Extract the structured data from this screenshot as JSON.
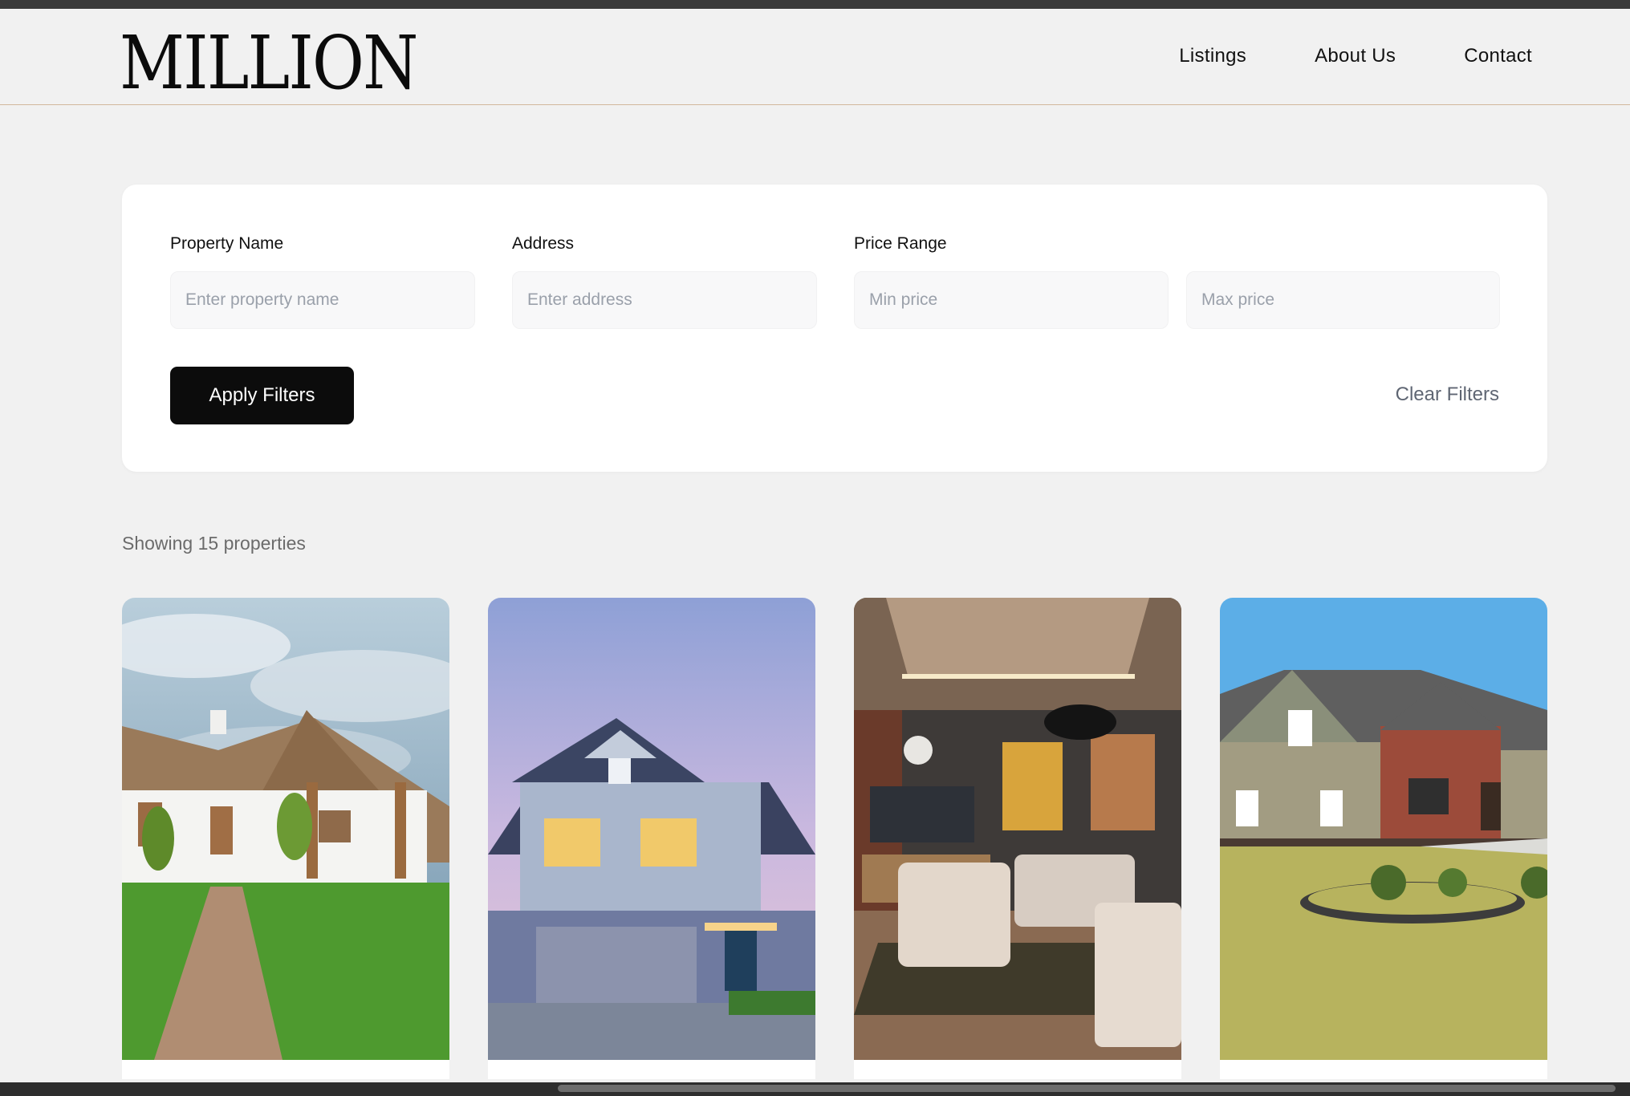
{
  "header": {
    "logo": "MILLION",
    "nav": [
      "Listings",
      "About Us",
      "Contact"
    ]
  },
  "filters": {
    "property_name": {
      "label": "Property Name",
      "placeholder": "Enter property name"
    },
    "address": {
      "label": "Address",
      "placeholder": "Enter address"
    },
    "price_range": {
      "label": "Price Range",
      "min_placeholder": "Min price",
      "max_placeholder": "Max price"
    },
    "apply_label": "Apply Filters",
    "clear_label": "Clear Filters"
  },
  "results": {
    "summary": "Showing 15 properties"
  },
  "colors": {
    "accent_border": "#d2b89c",
    "button_bg": "#0c0c0c",
    "page_bg": "#f1f1f1"
  }
}
